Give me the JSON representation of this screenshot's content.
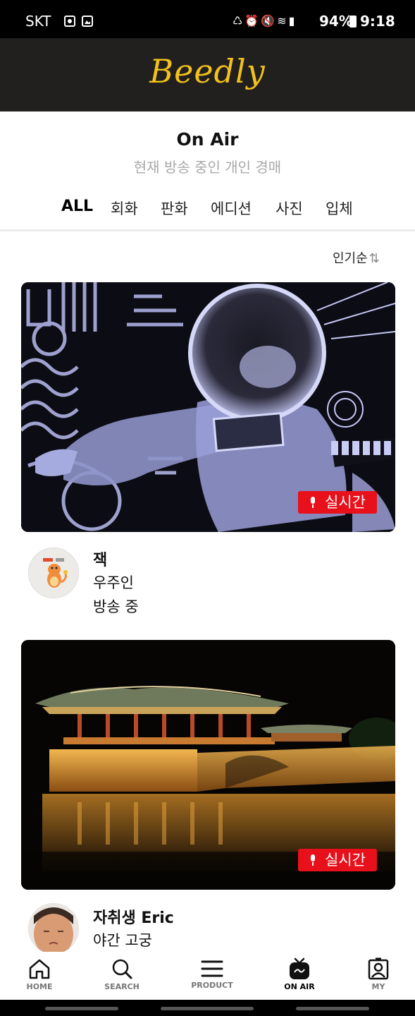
{
  "status_bar": {
    "carrier": "SKT",
    "battery": "94%",
    "time": "9:18"
  },
  "header": {
    "logo": "Beedly",
    "brand_color": "#f2c21b"
  },
  "page": {
    "title": "On Air",
    "subtitle": "현재 방송 중인 개인 경매"
  },
  "tabs": [
    {
      "label": "ALL",
      "active": true
    },
    {
      "label": "회화"
    },
    {
      "label": "판화"
    },
    {
      "label": "에디션"
    },
    {
      "label": "사진"
    },
    {
      "label": "입체"
    }
  ],
  "sort": {
    "label": "인기순",
    "icon": "sort-arrows-icon"
  },
  "live_color": "#e8101b",
  "streams": [
    {
      "live_label": "실시간",
      "name": "잭",
      "lines": [
        "우주인",
        "방송 중"
      ]
    },
    {
      "live_label": "실시간",
      "name": "자취생 Eric",
      "lines": [
        "야간 고궁"
      ]
    }
  ],
  "bottom_nav": [
    {
      "label": "HOME",
      "icon": "home-icon"
    },
    {
      "label": "SEARCH",
      "icon": "search-icon"
    },
    {
      "label": "PRODUCT",
      "icon": "menu-icon"
    },
    {
      "label": "ON AIR",
      "icon": "tv-icon",
      "active": true
    },
    {
      "label": "MY",
      "icon": "profile-icon"
    }
  ]
}
